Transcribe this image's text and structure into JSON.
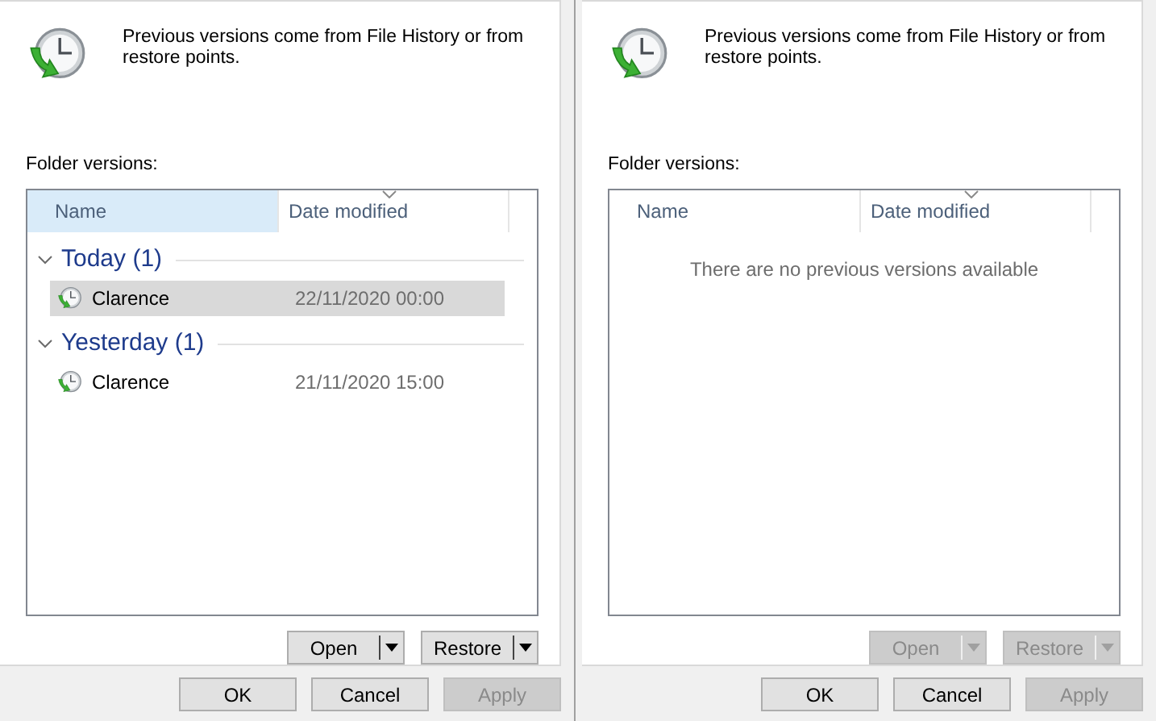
{
  "panels": [
    {
      "description": "Previous versions come from File History or from restore points.",
      "folder_label": "Folder versions:",
      "columns": [
        {
          "label": "Name",
          "highlighted": true,
          "sorted": false
        },
        {
          "label": "Date modified",
          "highlighted": false,
          "sorted": true
        }
      ],
      "groups": [
        {
          "label": "Today (1)",
          "expanded": true,
          "items": [
            {
              "name": "Clarence",
              "date": "22/11/2020 00:00",
              "selected": true
            }
          ]
        },
        {
          "label": "Yesterday (1)",
          "expanded": true,
          "items": [
            {
              "name": "Clarence",
              "date": "21/11/2020 15:00",
              "selected": false
            }
          ]
        }
      ],
      "actions": [
        {
          "label": "Open",
          "disabled": false
        },
        {
          "label": "Restore",
          "disabled": false
        }
      ],
      "footer": [
        {
          "label": "OK",
          "disabled": false
        },
        {
          "label": "Cancel",
          "disabled": false
        },
        {
          "label": "Apply",
          "disabled": true
        }
      ]
    },
    {
      "description": "Previous versions come from File History or from restore points.",
      "folder_label": "Folder versions:",
      "columns": [
        {
          "label": "Name",
          "highlighted": false,
          "sorted": false
        },
        {
          "label": "Date modified",
          "highlighted": false,
          "sorted": true
        }
      ],
      "empty_message": "There are no previous versions available",
      "actions": [
        {
          "label": "Open",
          "disabled": true
        },
        {
          "label": "Restore",
          "disabled": true
        }
      ],
      "footer": [
        {
          "label": "OK",
          "disabled": false
        },
        {
          "label": "Cancel",
          "disabled": false
        },
        {
          "label": "Apply",
          "disabled": true
        }
      ]
    }
  ]
}
